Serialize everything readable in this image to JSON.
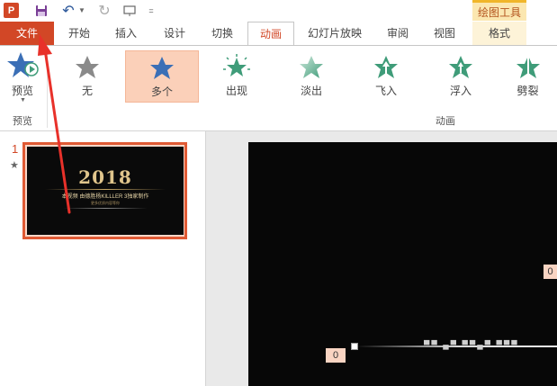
{
  "qat": {
    "app_icon_label": "P",
    "more_label": "="
  },
  "context_tab_group": "绘图工具",
  "tabs": [
    {
      "id": "file",
      "label": "文件"
    },
    {
      "id": "home",
      "label": "开始"
    },
    {
      "id": "insert",
      "label": "插入"
    },
    {
      "id": "design",
      "label": "设计"
    },
    {
      "id": "transitions",
      "label": "切换"
    },
    {
      "id": "animation",
      "label": "动画"
    },
    {
      "id": "slideshow",
      "label": "幻灯片放映"
    },
    {
      "id": "review",
      "label": "审阅"
    },
    {
      "id": "view",
      "label": "视图"
    },
    {
      "id": "format",
      "label": "格式"
    }
  ],
  "ribbon": {
    "preview_label": "预览",
    "preview_group_label": "预览",
    "animation_group_label": "动画",
    "animations": [
      {
        "label": "无",
        "icon": "star-gray-icon",
        "color": "#8a8a8a"
      },
      {
        "label": "多个",
        "icon": "star-blue-icon",
        "color": "#3b6fb6",
        "selected": true
      },
      {
        "label": "出现",
        "icon": "star-burst-green-icon",
        "color": "#3f9c79"
      },
      {
        "label": "淡出",
        "icon": "star-fade-green-icon",
        "color": "#6fb79b"
      },
      {
        "label": "飞入",
        "icon": "star-flyin-green-icon",
        "color": "#3f9c79"
      },
      {
        "label": "浮入",
        "icon": "star-float-green-icon",
        "color": "#3f9c79"
      },
      {
        "label": "劈裂",
        "icon": "star-split-green-icon",
        "color": "#3f9c79"
      }
    ]
  },
  "thumbnails": {
    "slide_number": "1",
    "slide_star": "★",
    "slide": {
      "year": "2018",
      "subtitle": "本视频 由德胜杨KILLLER 3独家制作",
      "subtitle2": "更多优质内容等你"
    }
  },
  "main_slide": {
    "scrolling_text": "▀▀ ▄▀ ▀▀▄▀ ▀▀▀",
    "anim_tag_left": "0",
    "anim_tag_right": "0"
  },
  "colors": {
    "accent": "#d24726",
    "selected_item": "#fbd0b9",
    "context_tab": "#fbe7b0"
  }
}
